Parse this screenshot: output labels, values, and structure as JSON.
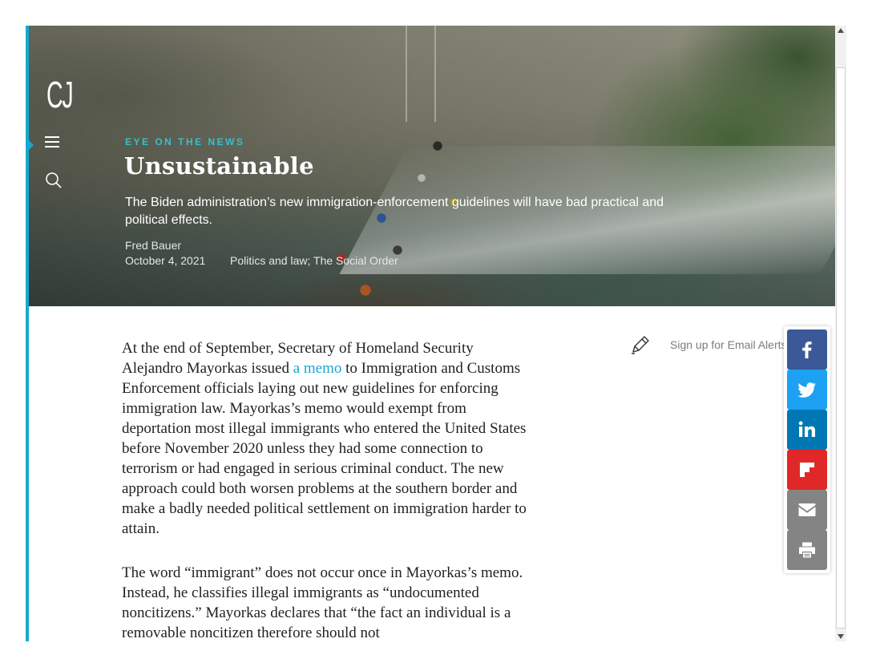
{
  "site": {
    "logo_text": "CJ"
  },
  "hero": {
    "kicker": "EYE ON THE NEWS",
    "headline": "Unsustainable",
    "dek": "The Biden administration’s new immigration-enforcement guidelines will have bad practical and political effects.",
    "author": "Fred Bauer",
    "date": "October 4, 2021",
    "categories": "Politics and law; The Social Order"
  },
  "article": {
    "p1_before_link": "At the end of September, Secretary of Homeland Security Alejandro Mayorkas issued ",
    "p1_link": "a memo",
    "p1_after_link": " to Immigration and Customs Enforcement officials laying out new guidelines for enforcing immigration law. Mayorkas’s memo would exempt from deportation most illegal immigrants who entered the United States before November 2020 unless they had some connection to terrorism or had engaged in serious criminal conduct. The new approach could both worsen problems at the southern border and make a badly needed political settlement on immigration harder to attain.",
    "p2": "The word “immigrant” does not occur once in Mayorkas’s memo. Instead, he classifies illegal immigrants as “undocumented noncitizens.” Mayorkas declares that “the fact an individual is a removable noncitizen therefore should not"
  },
  "email_signup": {
    "label": "Sign up for Email Alerts"
  },
  "share": [
    {
      "name": "facebook",
      "icon": "facebook-icon",
      "color": "#3b5998"
    },
    {
      "name": "twitter",
      "icon": "twitter-icon",
      "color": "#1da1f2"
    },
    {
      "name": "linkedin",
      "icon": "linkedin-icon",
      "color": "#0077b5"
    },
    {
      "name": "flipboard",
      "icon": "flipboard-icon",
      "color": "#e12828"
    },
    {
      "name": "email",
      "icon": "mail-icon",
      "color": "#848484"
    },
    {
      "name": "print",
      "icon": "print-icon",
      "color": "#848484"
    }
  ],
  "colors": {
    "accent": "#17a8cf",
    "kicker": "#2fc2d2",
    "link": "#17a8cf"
  }
}
